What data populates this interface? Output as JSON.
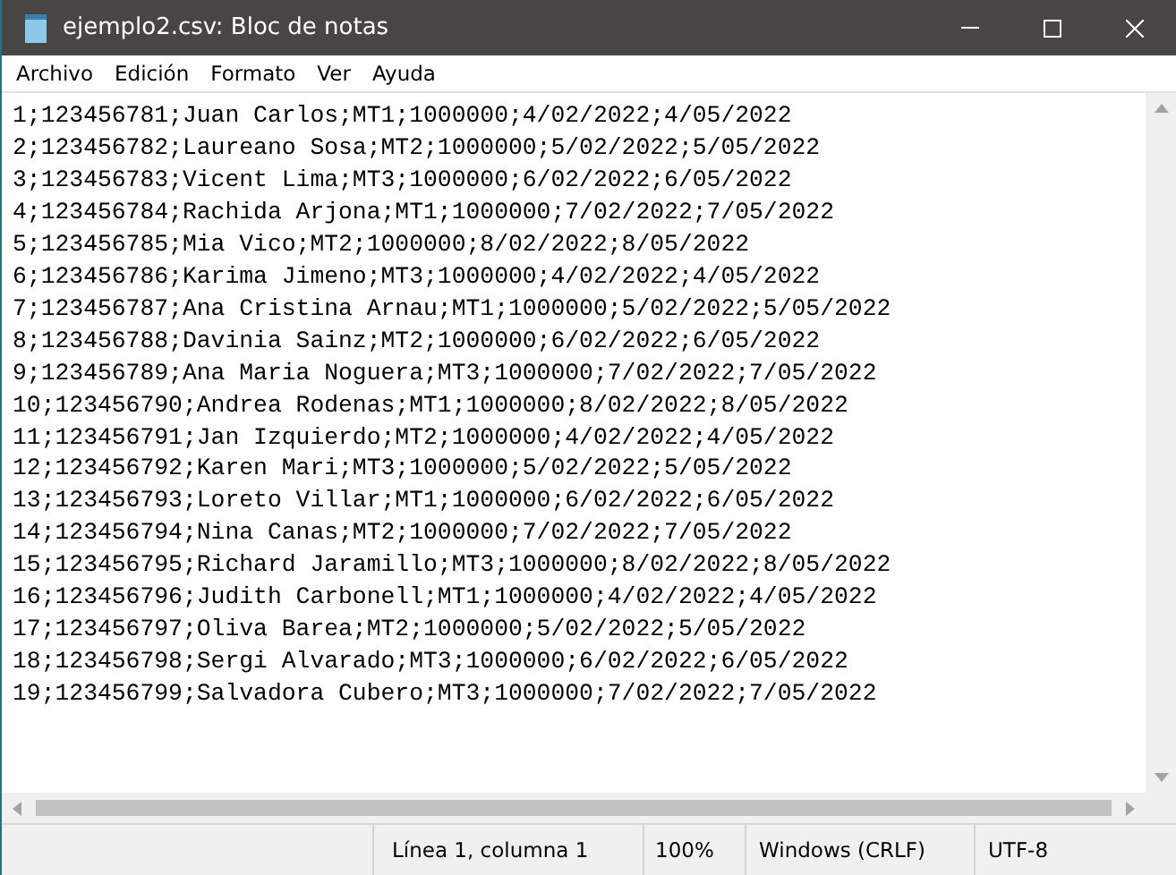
{
  "window": {
    "title": "ejemplo2.csv: Bloc de notas"
  },
  "menu": [
    "Archivo",
    "Edición",
    "Formato",
    "Ver",
    "Ayuda"
  ],
  "lines": [
    "1;123456781;Juan Carlos;MT1;1000000;4/02/2022;4/05/2022",
    "2;123456782;Laureano Sosa;MT2;1000000;5/02/2022;5/05/2022",
    "3;123456783;Vicent Lima;MT3;1000000;6/02/2022;6/05/2022",
    "4;123456784;Rachida Arjona;MT1;1000000;7/02/2022;7/05/2022",
    "5;123456785;Mia Vico;MT2;1000000;8/02/2022;8/05/2022",
    "6;123456786;Karima Jimeno;MT3;1000000;4/02/2022;4/05/2022",
    "7;123456787;Ana Cristina Arnau;MT1;1000000;5/02/2022;5/05/2022",
    "8;123456788;Davinia Sainz;MT2;1000000;6/02/2022;6/05/2022",
    "9;123456789;Ana Maria Noguera;MT3;1000000;7/02/2022;7/05/2022",
    "10;123456790;Andrea Rodenas;MT1;1000000;8/02/2022;8/05/2022",
    "11;123456791;Jan Izquierdo;MT2;1000000;4/02/2022;4/05/2022",
    "12;123456792;Karen Mari;MT3;1000000;5/02/2022;5/05/2022",
    "13;123456793;Loreto Villar;MT1;1000000;6/02/2022;6/05/2022",
    "14;123456794;Nina Canas;MT2;1000000;7/02/2022;7/05/2022",
    "15;123456795;Richard Jaramillo;MT3;1000000;8/02/2022;8/05/2022",
    "16;123456796;Judith Carbonell;MT1;1000000;4/02/2022;4/05/2022",
    "17;123456797;Oliva Barea;MT2;1000000;5/02/2022;5/05/2022",
    "18;123456798;Sergi Alvarado;MT3;1000000;6/02/2022;6/05/2022",
    "19;123456799;Salvadora Cubero;MT3;1000000;7/02/2022;7/05/2022"
  ],
  "status_bar": {
    "position": "Línea 1, columna 1",
    "zoom": "100%",
    "line_ending": "Windows (CRLF)",
    "encoding": "UTF-8"
  }
}
